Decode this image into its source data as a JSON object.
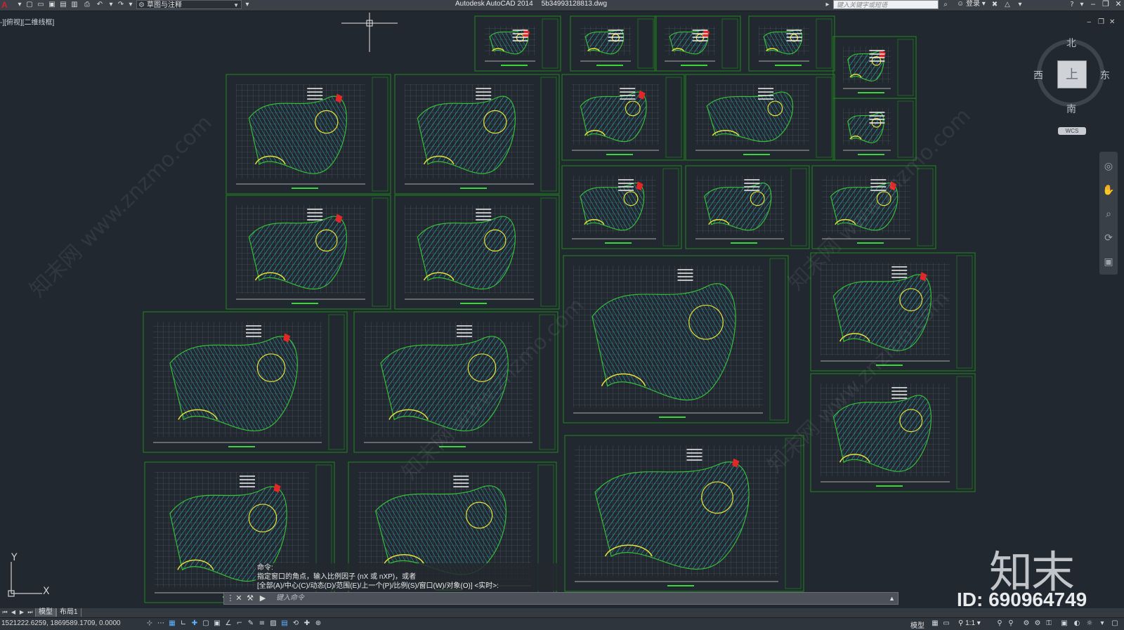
{
  "titlebar": {
    "logo": "A",
    "quick_access": [
      "new-icon",
      "open-icon",
      "save-icon",
      "saveas-icon",
      "print-icon",
      "undo-icon",
      "redo-icon"
    ],
    "workspace": "草图与注释",
    "app_name": "Autodesk AutoCAD 2014",
    "file_name": "5b34993128813.dwg",
    "search_placeholder": "键入关键字或短语",
    "login_label": "登录"
  },
  "viewport": {
    "label": "-][俯视][二维线框]"
  },
  "viewcube": {
    "top_face": "上",
    "north": "北",
    "south": "南",
    "east": "东",
    "west": "西",
    "wcs": "WCS"
  },
  "ucs": {
    "x": "X",
    "y": "Y"
  },
  "command": {
    "history": [
      "命令:",
      "指定窗口的角点，输入比例因子 (nX 或 nXP)，或者",
      "[全部(A)/中心(C)/动态(D)/范围(E)/上一个(P)/比例(S)/窗口(W)/对象(O)] <实时>:"
    ],
    "placeholder": "键入命令"
  },
  "tabs": {
    "items": [
      "模型",
      "布局1"
    ],
    "active": 0
  },
  "status": {
    "coords": "1521222.6259, 1869589.1709, 0.0000",
    "model_label": "模型",
    "scale_label": "1:1"
  },
  "watermark": {
    "logo": "知末",
    "id": "ID: 690964749",
    "site": "知末网 www.znzmo.com"
  },
  "colors": {
    "background": "#212830",
    "sheet_border": "#1f7a1f",
    "hatch_cyan": "#2ad4e0",
    "accent_yellow": "#e8e23a",
    "accent_red": "#e02828",
    "accent_green": "#3ad63a"
  }
}
